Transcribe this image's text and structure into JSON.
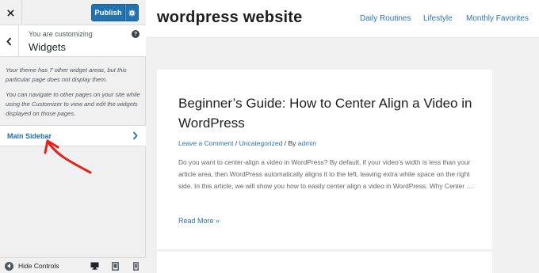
{
  "panel": {
    "publish_label": "Publish",
    "customizing_label": "You are customizing",
    "section_title": "Widgets",
    "description_1": "Your theme has 7 other widget areas, but this particular page does not display them.",
    "description_2": "You can navigate to other pages on your site while using the Customizer to view and edit the widgets displayed on those pages.",
    "main_sidebar_label": "Main Sidebar",
    "hide_controls_label": "Hide Controls",
    "colors": {
      "accent": "#2271b1",
      "annotation_arrow": "#e0221b"
    }
  },
  "site": {
    "title": "wordpress website",
    "nav": [
      "Daily Routines",
      "Lifestyle",
      "Monthly Favorites"
    ],
    "article": {
      "title": "Beginner’s Guide: How to Center Align a Video in WordPress",
      "comment_link": "Leave a Comment",
      "category": "Uncategorized",
      "author": "admin",
      "excerpt": "Do you want to center-align a video in WordPress? By default, if your video’s width is less than your article area, then WordPress automatically aligns it to the left, leaving extra white space on the right side. In this article, we will show you how to easily center align a video in WordPress.  Why Center …",
      "read_more": "Read More »"
    },
    "link_color": "#2c74b5"
  }
}
